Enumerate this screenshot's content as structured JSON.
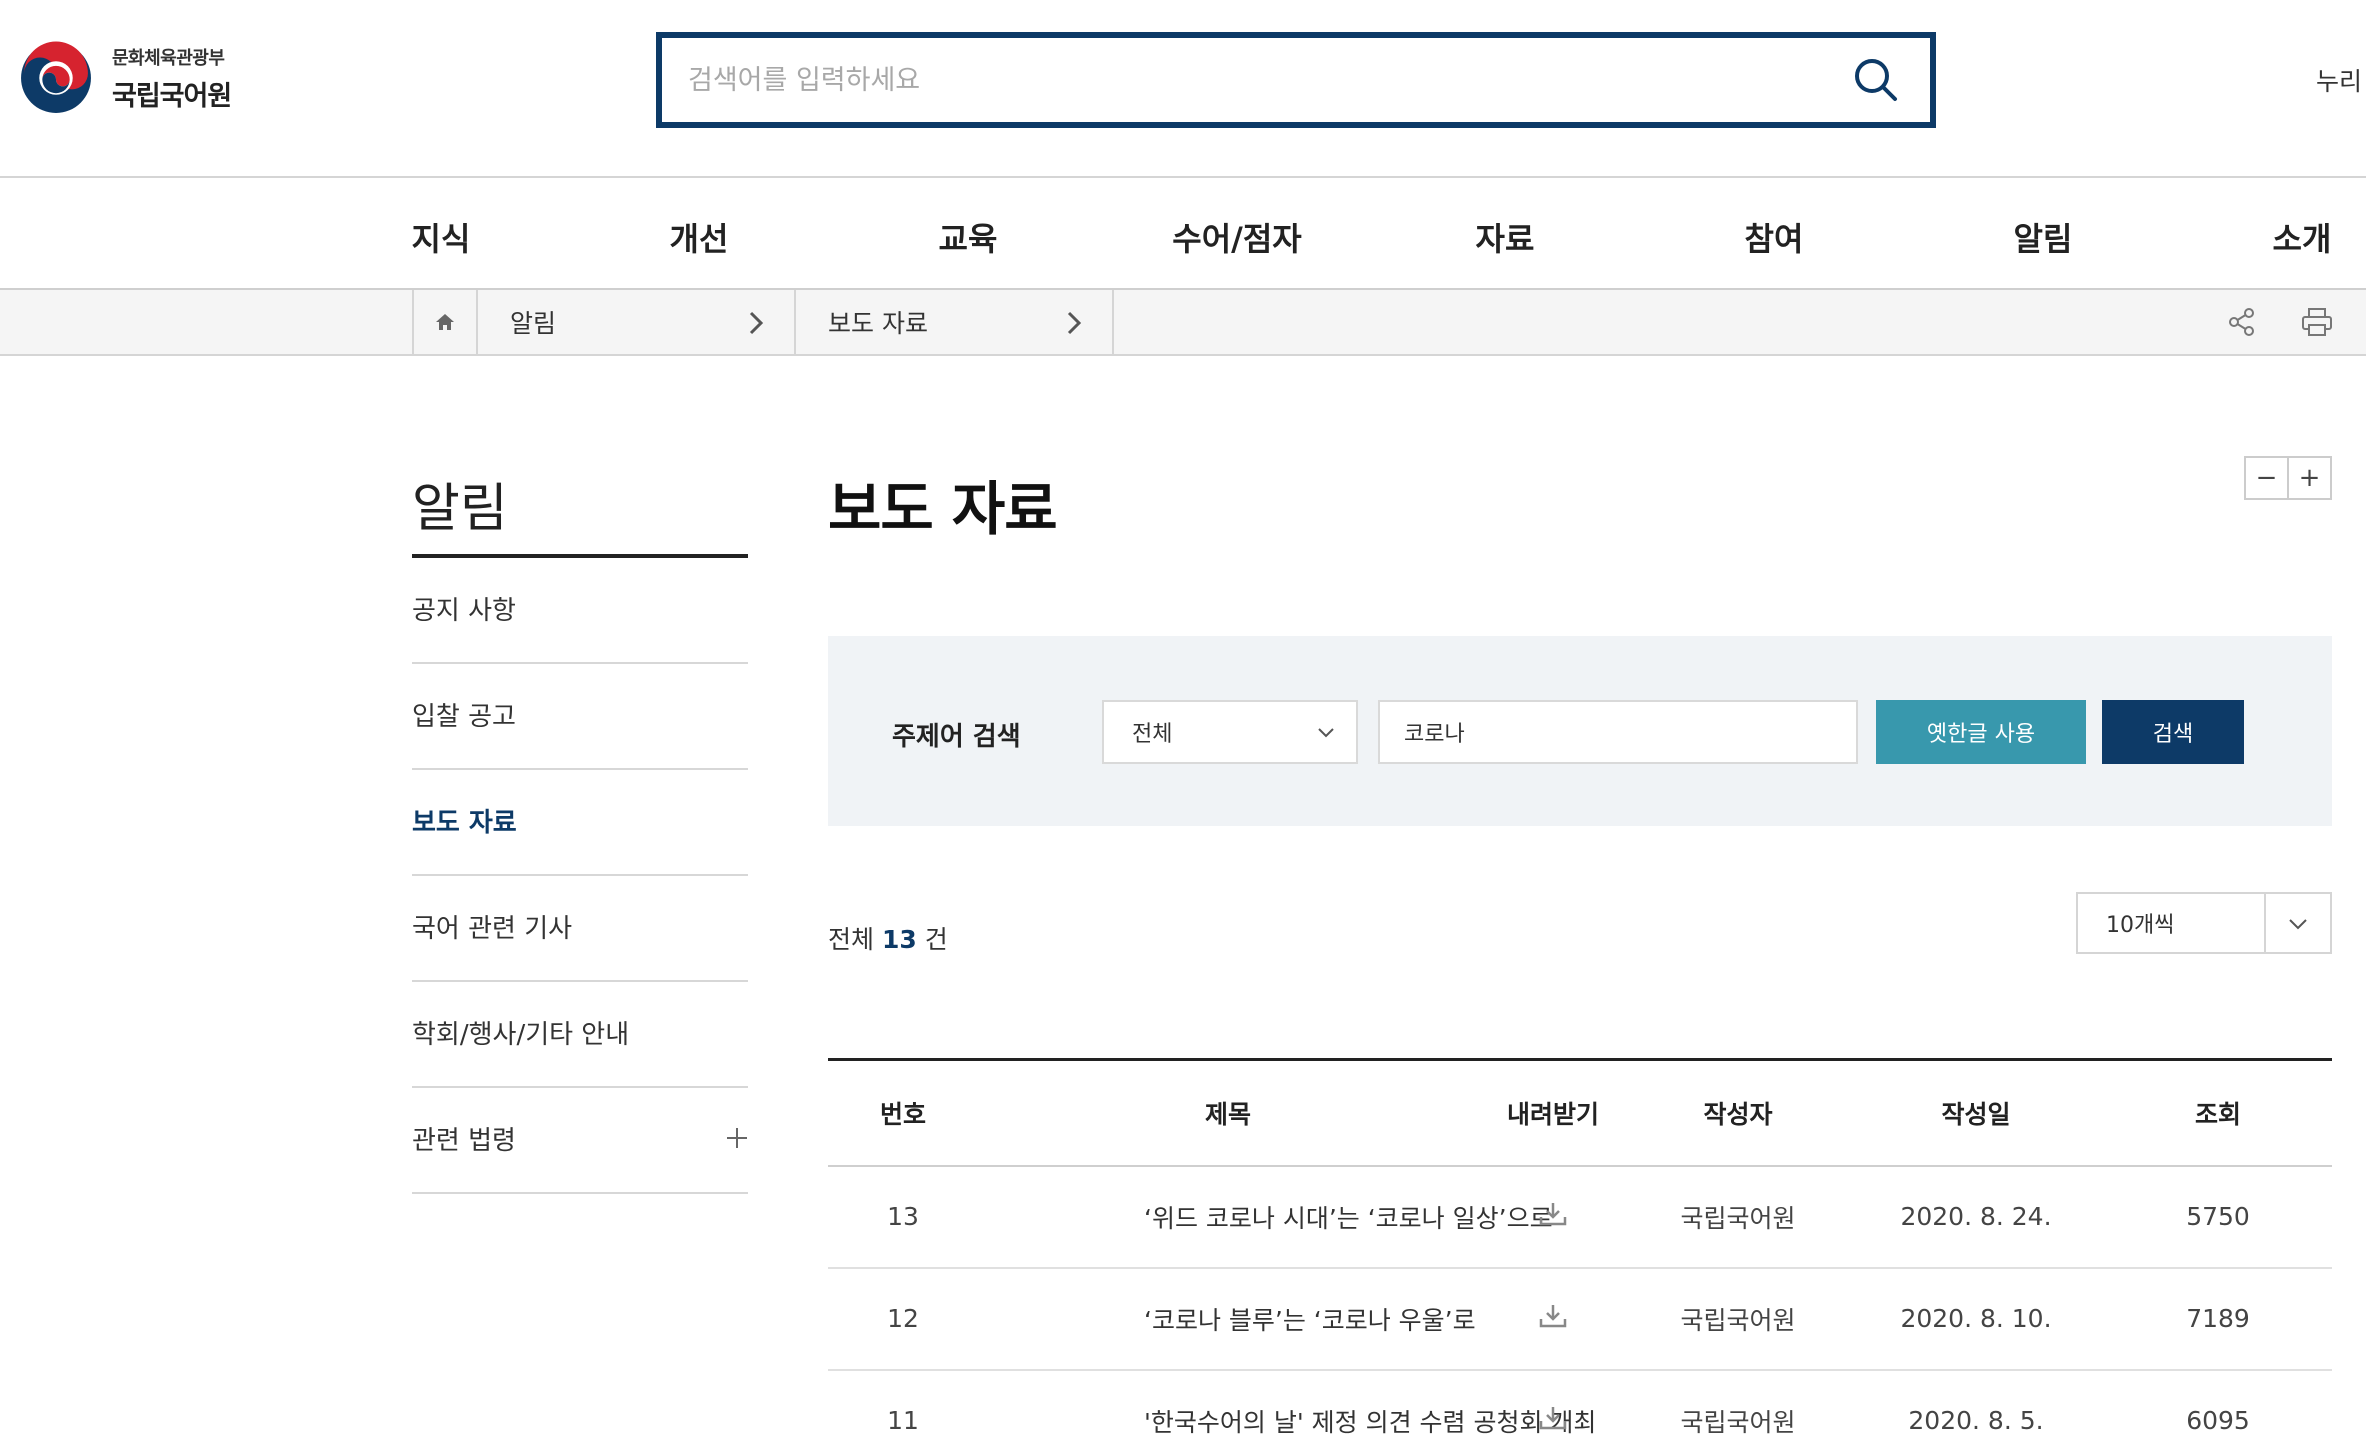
{
  "header": {
    "ministry": "문화체육관광부",
    "institute": "국립국어원",
    "search_placeholder": "검색어를 입력하세요",
    "nuri_link": "누리"
  },
  "gnb": {
    "items": [
      {
        "label": "지식"
      },
      {
        "label": "개선"
      },
      {
        "label": "교육"
      },
      {
        "label": "수어/점자"
      },
      {
        "label": "자료"
      },
      {
        "label": "참여"
      },
      {
        "label": "알림"
      },
      {
        "label": "소개"
      }
    ]
  },
  "breadcrumb": {
    "items": [
      {
        "label": "알림"
      },
      {
        "label": "보도 자료"
      }
    ]
  },
  "lnb": {
    "title": "알림",
    "items": [
      {
        "label": "공지 사항"
      },
      {
        "label": "입찰 공고"
      },
      {
        "label": "보도 자료"
      },
      {
        "label": "국어 관련 기사"
      },
      {
        "label": "학회/행사/기타 안내"
      },
      {
        "label": "관련 법령"
      }
    ],
    "active_index": 2
  },
  "content": {
    "page_title": "보도 자료",
    "zoom_out_label": "−",
    "zoom_in_label": "+"
  },
  "filter": {
    "label": "주제어 검색",
    "select_value": "전체",
    "keyword": "코로나",
    "old_hangul_button": "옛한글 사용",
    "search_button": "검색"
  },
  "list_info": {
    "total_prefix": "전체",
    "total_count": "13",
    "total_suffix": "건",
    "per_page": "10개씩"
  },
  "table": {
    "headers": [
      "번호",
      "제목",
      "내려받기",
      "작성자",
      "작성일",
      "조회"
    ],
    "rows": [
      {
        "no": "13",
        "title": "‘위드 코로나 시대’는 ‘코로나 일상’으로",
        "author": "국립국어원",
        "date": "2020. 8. 24.",
        "views": "5750"
      },
      {
        "no": "12",
        "title": "‘코로나 블루’는 ‘코로나 우울’로",
        "author": "국립국어원",
        "date": "2020. 8. 10.",
        "views": "7189"
      },
      {
        "no": "11",
        "title": "'한국수어의 날' 제정 의견 수렴 공청회 개최",
        "author": "국립국어원",
        "date": "2020. 8. 5.",
        "views": "6095"
      }
    ]
  },
  "colors": {
    "primary": "#0d3a67",
    "accent": "#3898ad",
    "filter_bg": "#f0f3f6"
  },
  "icons": {
    "search": "search-icon",
    "home": "home-icon",
    "share": "share-icon",
    "print": "print-icon",
    "download": "download-icon"
  }
}
